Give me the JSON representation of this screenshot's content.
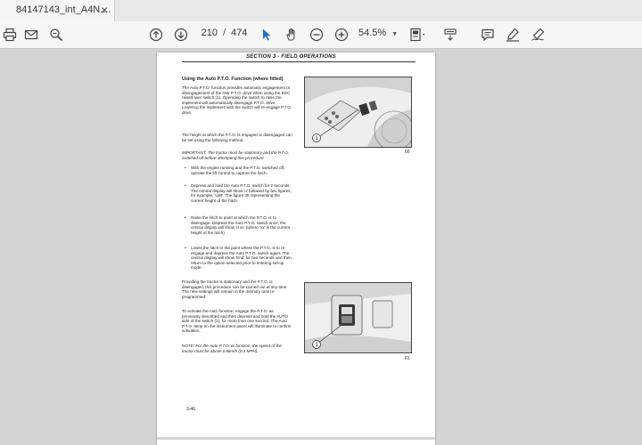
{
  "tab": {
    "title": "84147143_int_A4N....",
    "close": "×"
  },
  "toolbar": {
    "page_current": "210",
    "page_total": "474",
    "zoom": "54.5%"
  },
  "document": {
    "header": "SECTION 3  - FIELD OPERATIONS",
    "heading": "Using the Auto P.T.O. Function (where fitted)",
    "para1": "The Auto P.T.O. function provides automatic engagement or disengagement of the rear P.T.O. drive when using the EDC raise/lower switch (1). Operating the switch to raise the implement will automatically disengage P.T.O. drive. Lowering the implement with the switch will re-engage P.T.O. drive.",
    "para2": "The height at which the P.T.O. is engaged or disengaged can be set using the following method.",
    "important": "IMPORTANT: The tractor must be stationary and the P.T.O. switched off before attempting this procedure.",
    "bullets": [
      "With the engine running and the P.T.O. switched off, operate the lift control to capture the hitch.",
      "Depress and hold the Auto P.T.O. switch for 2 seconds. The central display will show 'u' followed by two figures, for example, 'u38'. The figure 38 representing the current height of the hitch.",
      "Raise the hitch to point at which the P.T.O. is to disengage. Depress the Auto P.T.O. switch once, the central display will show 'd xx' (where 'xx' is the current height of the hitch).",
      "Lower the hitch to the point where the P.T.O. is to re-engage and depress the Auto P.T.O. switch again. The central display will show 'End' for two seconds and then return to the option selected prior to entering set-up mode."
    ],
    "para3": "Providing the tractor is stationary and the P.T.O. is disengaged, this procedure can be carried out at any time. The new settings will remain in the memory until re-programmed.",
    "para4": "To activate the Auto function, engage the P.T.O. as previously described and then depress and hold the AUTO side of the switch (1), for more than one second. The Auto P.T.O. lamp on the instrument panel will illuminate to confirm activation.",
    "note": "NOTE: For the Auto P.T.O. to function, the speed of the tractor must be above 0.5km/h (0.3 MPH).",
    "fig1_num": "60",
    "fig2_num": "61",
    "fig_callout": "1",
    "page_number": "3-46"
  },
  "icons": [
    "print-icon",
    "email-icon",
    "search-zoom-icon",
    "page-up-icon",
    "page-down-icon",
    "select-cursor-icon",
    "hand-icon",
    "zoom-out-icon",
    "zoom-in-icon",
    "fit-page-icon",
    "scroll-mode-icon",
    "comment-icon",
    "highlight-icon",
    "sign-icon"
  ]
}
